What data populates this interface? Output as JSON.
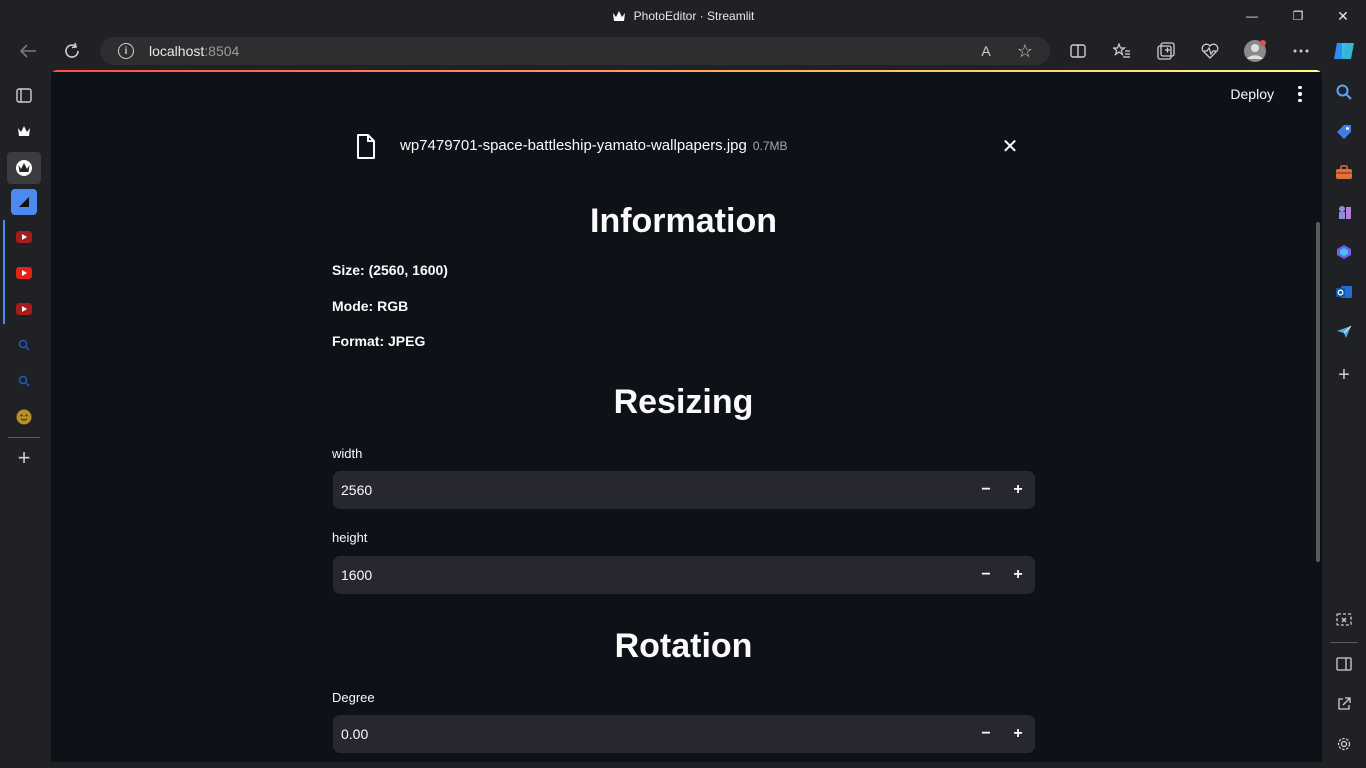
{
  "window": {
    "title": "PhotoEditor · Streamlit",
    "controls": {
      "minimize": "—",
      "restore": "❐",
      "close": "✕"
    }
  },
  "browser": {
    "address_host": "localhost",
    "address_port": ":8504",
    "read_aloud_icon": "A",
    "favorite_icon": "☆"
  },
  "left_rail": {
    "items": [
      {
        "name": "tab-actions-icon"
      },
      {
        "name": "tab-streamlit-1"
      },
      {
        "name": "tab-streamlit-2"
      },
      {
        "name": "tab-app"
      },
      {
        "name": "tab-youtube-1"
      },
      {
        "name": "tab-youtube-2"
      },
      {
        "name": "tab-youtube-3"
      },
      {
        "name": "tab-search-1"
      },
      {
        "name": "tab-search-2"
      },
      {
        "name": "tab-emoji"
      }
    ],
    "new_tab": "+"
  },
  "streamlit": {
    "deploy_label": "Deploy",
    "uploaded_file": {
      "name": "wp7479701-space-battleship-yamato-wallpapers.jpg",
      "size": "0.7MB",
      "close": "✕"
    },
    "info_section": {
      "title": "Information",
      "size": "Size: (2560, 1600)",
      "mode": "Mode: RGB",
      "format": "Format: JPEG"
    },
    "resize_section": {
      "title": "Resizing",
      "width_label": "width",
      "width_value": "2560",
      "height_label": "height",
      "height_value": "1600"
    },
    "rotation_section": {
      "title": "Rotation",
      "degree_label": "Degree",
      "degree_value": "0.00"
    },
    "stepper": {
      "minus": "−",
      "plus": "+"
    }
  },
  "colors": {
    "app_bg": "#0e1117",
    "input_bg": "#262730",
    "browser_bg": "#202124",
    "accent_red": "#ff4b4b",
    "accent_yellow": "#fffd80"
  }
}
